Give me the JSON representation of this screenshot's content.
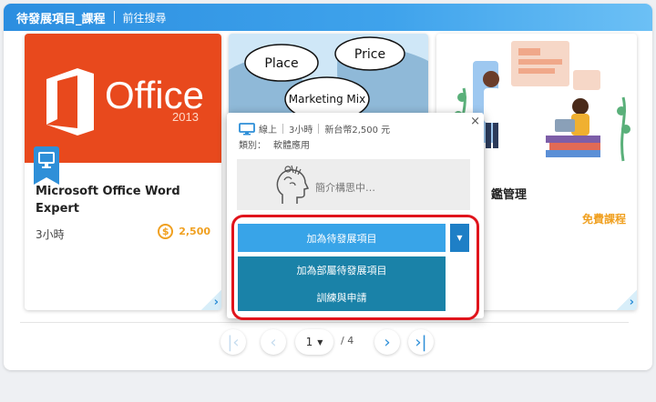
{
  "header": {
    "title": "待發展項目_課程",
    "link": "前往搜尋"
  },
  "cards": [
    {
      "title": "Microsoft Office Word Expert",
      "duration": "3小時",
      "price": "2,500",
      "brand": "Office",
      "year": "2013"
    },
    {
      "bubbles": [
        "Place",
        "Price",
        "Marketing Mix"
      ]
    },
    {
      "title": "鑑管理",
      "tag": "免費課程"
    }
  ],
  "popup": {
    "mode": "線上",
    "duration": "3小時",
    "price": "新台幣2,500 元",
    "category_label": "類別：",
    "category_value": "軟體應用",
    "intro": "簡介構思中…",
    "close": "×",
    "add_button": "加為待發展項目",
    "menu": [
      "加為部屬待發展項目",
      "訓練與申請"
    ]
  },
  "pager": {
    "current": "1",
    "total": "/ 4"
  },
  "colors": {
    "accent": "#2e8fd8",
    "price": "#f0a020",
    "highlight": "#e0141c",
    "menu": "#1a82a8"
  }
}
